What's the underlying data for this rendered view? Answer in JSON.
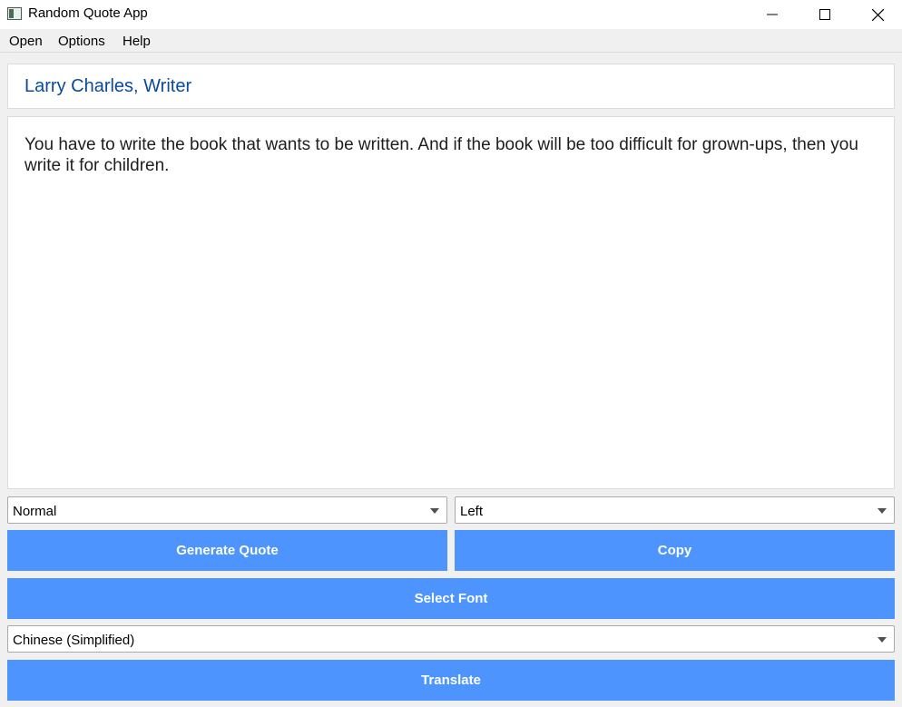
{
  "window": {
    "title": "Random Quote App",
    "controls": [
      "minimize-icon",
      "maximize-icon",
      "close-icon"
    ]
  },
  "menu": {
    "items": [
      {
        "label": "Open"
      },
      {
        "label": "Options"
      },
      {
        "label": "Help"
      }
    ]
  },
  "quote": {
    "author": "Larry Charles, Writer",
    "text": "You have to write the book that wants to be written. And if the book will be too difficult for grown-ups, then you write it for children."
  },
  "controls": {
    "style_select": "Normal",
    "align_select": "Left",
    "generate_label": "Generate Quote",
    "copy_label": "Copy",
    "font_label": "Select Font",
    "language_select": "Chinese (Simplified)",
    "translate_label": "Translate"
  },
  "colors": {
    "button_bg": "#4d94ff",
    "author_text": "#0a4a9a"
  }
}
